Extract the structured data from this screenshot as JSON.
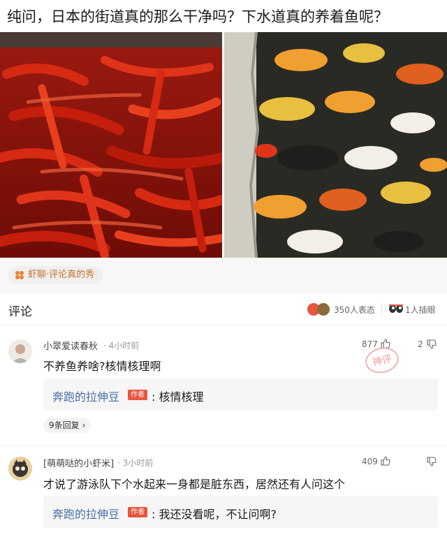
{
  "post": {
    "title": "纯问，日本的街道真的那么干净吗？下水道真的养着鱼呢？"
  },
  "topic": {
    "label": "虾聊·评论真的秀",
    "accent": "#c8702c"
  },
  "comments_header": {
    "title": "评论",
    "reactions_label": "350人表态",
    "viewers_label": "1人插眼"
  },
  "comments": [
    {
      "user": "小翠爱读春秋",
      "time": "· 4小时前",
      "likes": "877",
      "dislikes": "2",
      "text": "不养鱼养啥?核情核理啊",
      "reply": {
        "author": "奔跑的拉伸豆",
        "badge": "作者",
        "text": ": 核情核理"
      },
      "reply_count": "9条回复 ›",
      "stamp": "神评"
    },
    {
      "user": "[萌萌哒的小虾米]",
      "time": "· 3小时前",
      "likes": "409",
      "text": "才说了游泳队下个水起来一身都是脏东西，居然还有人问这个",
      "reply": {
        "author": "奔跑的拉伸豆",
        "badge": "作者",
        "text": ": 我还没看呢，不让问啊?"
      }
    }
  ],
  "colors": {
    "link_blue": "#4a6ea8",
    "author_badge": "#e8543e"
  }
}
